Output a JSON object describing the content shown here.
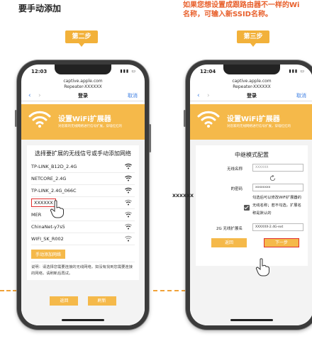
{
  "headings": {
    "left": "要手动添加",
    "right_line1": "如果您想设置成跟路由器不一样的Wi",
    "right_line2": "名称，可输入新SSID名称。"
  },
  "steps": {
    "step2": "第二步",
    "step3": "第三步"
  },
  "phone_left": {
    "time": "12:03",
    "url_host": "captive.apple.com",
    "url_ssid": "Repeater-XXXXXX",
    "nav_title": "登录",
    "nav_cancel": "取消",
    "banner_title": "设置WiFi扩展器",
    "banner_sub": "对您家的无线网络进行信号扩展，穿墙红红的",
    "list_title": "选择要扩展的无线信号或手动添加网络",
    "networks": [
      "TP-LINK_B12D_2.4G",
      "NETCORE_2.4G",
      "TP-LINK_2.4G_066C",
      "XXXXXX",
      "MER",
      "ChinaNet-y7s5",
      "WIFI_SK_R002"
    ],
    "manual_button": "手动添加网络",
    "note": "说明：请选择您需要连接的无线网络，如没有找到您需要连接的网络，请刷新后再试。",
    "back_button": "返回",
    "refresh_button": "刷新"
  },
  "phone_right": {
    "time": "12:04",
    "url_host": "captive.apple.com",
    "url_ssid": "Repeater-XXXXXX",
    "nav_title": "登录",
    "nav_cancel": "取消",
    "banner_title": "设置WiFi扩展器",
    "banner_sub": "对您家的无线网络进行信号扩展，穿墙红红的",
    "form_title": "中继模式配置",
    "ssid_label": "无线名称",
    "ssid_value": "XXXXXX",
    "password_label": "的密码",
    "password_value": "xxxxxxxx",
    "outside_password_prefix": "XXXXXX",
    "check_text": "勾选后可以修改WiFi扩展器的无线名称；若不勾选，扩展名称是默认的",
    "ext_name_label": "2G 无线扩展名",
    "ext_name_value": "XXXXXX-2.4G-ext",
    "back_button": "返回",
    "next_button": "下一步"
  }
}
